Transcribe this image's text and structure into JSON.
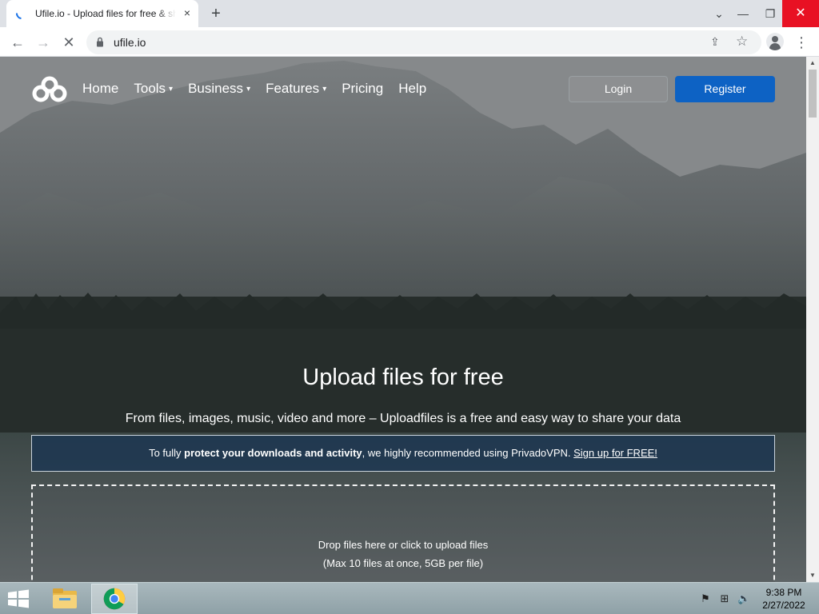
{
  "browser": {
    "tab_title": "Ufile.io - Upload files for free & share",
    "tab_close_icon": "×",
    "new_tab_icon": "+",
    "url": "ufile.io",
    "window_controls": {
      "minimize": "—",
      "restore": "❐",
      "close": "✕",
      "tab_search": "⌄"
    },
    "nav_icons": {
      "back": "←",
      "forward": "→",
      "reload": "✕"
    }
  },
  "site": {
    "nav": [
      {
        "label": "Home",
        "has_dropdown": false
      },
      {
        "label": "Tools",
        "has_dropdown": true
      },
      {
        "label": "Business",
        "has_dropdown": true
      },
      {
        "label": "Features",
        "has_dropdown": true
      },
      {
        "label": "Pricing",
        "has_dropdown": false
      },
      {
        "label": "Help",
        "has_dropdown": false
      }
    ],
    "caret": "▾",
    "login_label": "Login",
    "register_label": "Register",
    "hero_title": "Upload files for free",
    "hero_subtitle": "From files, images, music, video and more – Uploadfiles is a free and easy way to share your data",
    "vpn_banner": {
      "prefix": "To fully ",
      "bold": "protect your downloads and activity",
      "middle": ", we highly recommended using PrivadoVPN. ",
      "link": "Sign up for FREE!"
    },
    "dropzone": {
      "line1": "Drop files here or click to upload files",
      "line2": "(Max 10 files at once, 5GB per file)"
    }
  },
  "taskbar": {
    "time": "9:38 PM",
    "date": "2/27/2022"
  },
  "colors": {
    "register_bg": "#0d62c4",
    "close_button": "#e81123",
    "banner_bg": "#193452"
  }
}
